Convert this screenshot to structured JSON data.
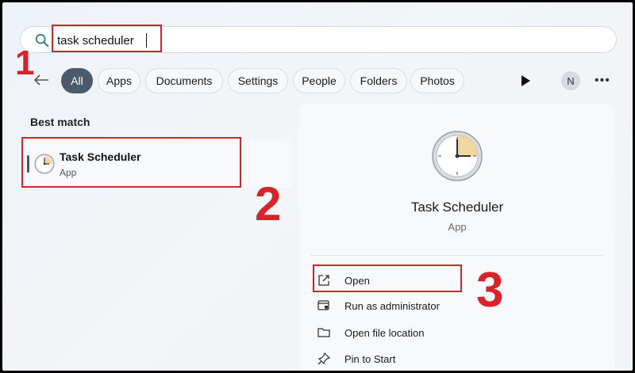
{
  "search": {
    "value": "task scheduler"
  },
  "filters": {
    "chips": [
      "All",
      "Apps",
      "Documents",
      "Settings",
      "People",
      "Folders",
      "Photos"
    ],
    "active": "All"
  },
  "avatar_initial": "N",
  "annotations": {
    "step1": "1",
    "step2": "2",
    "step3": "3",
    "box_color": "#d8232a"
  },
  "results": {
    "section_label": "Best match",
    "best": {
      "title": "Task Scheduler",
      "subtitle": "App",
      "icon": "clock-icon"
    }
  },
  "detail": {
    "title": "Task Scheduler",
    "subtitle": "App",
    "actions": [
      {
        "label": "Open",
        "icon": "open-external-icon"
      },
      {
        "label": "Run as administrator",
        "icon": "shield-admin-icon"
      },
      {
        "label": "Open file location",
        "icon": "folder-icon"
      },
      {
        "label": "Pin to Start",
        "icon": "pin-icon"
      }
    ]
  }
}
